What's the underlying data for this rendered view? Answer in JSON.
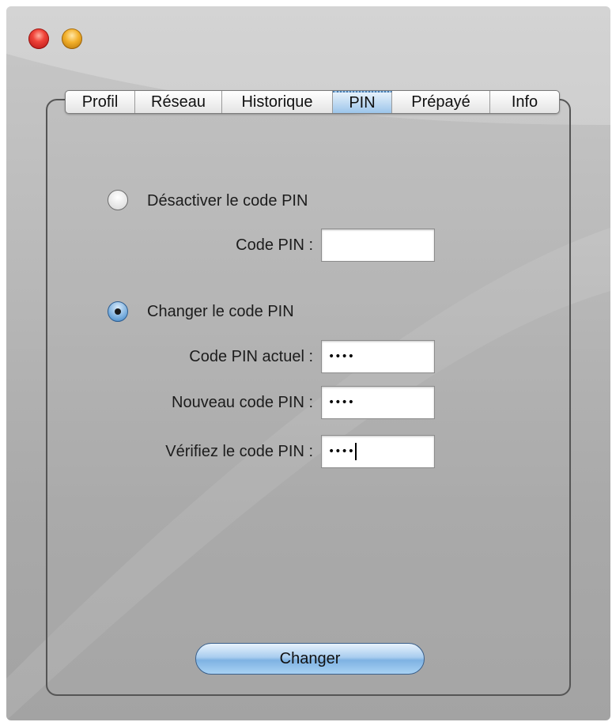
{
  "window": {
    "controls": [
      "close",
      "minimize"
    ]
  },
  "tabs": [
    {
      "label": "Profil",
      "selected": false
    },
    {
      "label": "Réseau",
      "selected": false
    },
    {
      "label": "Historique",
      "selected": false
    },
    {
      "label": "PIN",
      "selected": true
    },
    {
      "label": "Prépayé",
      "selected": false
    },
    {
      "label": "Info",
      "selected": false
    }
  ],
  "pin_form": {
    "disable_option": {
      "label": "Désactiver le code PIN",
      "checked": false,
      "code_label": "Code PIN :",
      "code_value": ""
    },
    "change_option": {
      "label": "Changer le code PIN",
      "checked": true,
      "current_label": "Code PIN actuel :",
      "current_value": "••••",
      "new_label": "Nouveau code PIN :",
      "new_value": "••••",
      "verify_label": "Vérifiez le code PIN :",
      "verify_value": "••••"
    },
    "submit_label": "Changer"
  },
  "colors": {
    "window_bg": "#b4b4b4",
    "selected_tab": "#9cc5ea",
    "button_blue": "#7eb2e2",
    "close_red": "#f0443a",
    "minimize_yellow": "#f3b12c"
  }
}
